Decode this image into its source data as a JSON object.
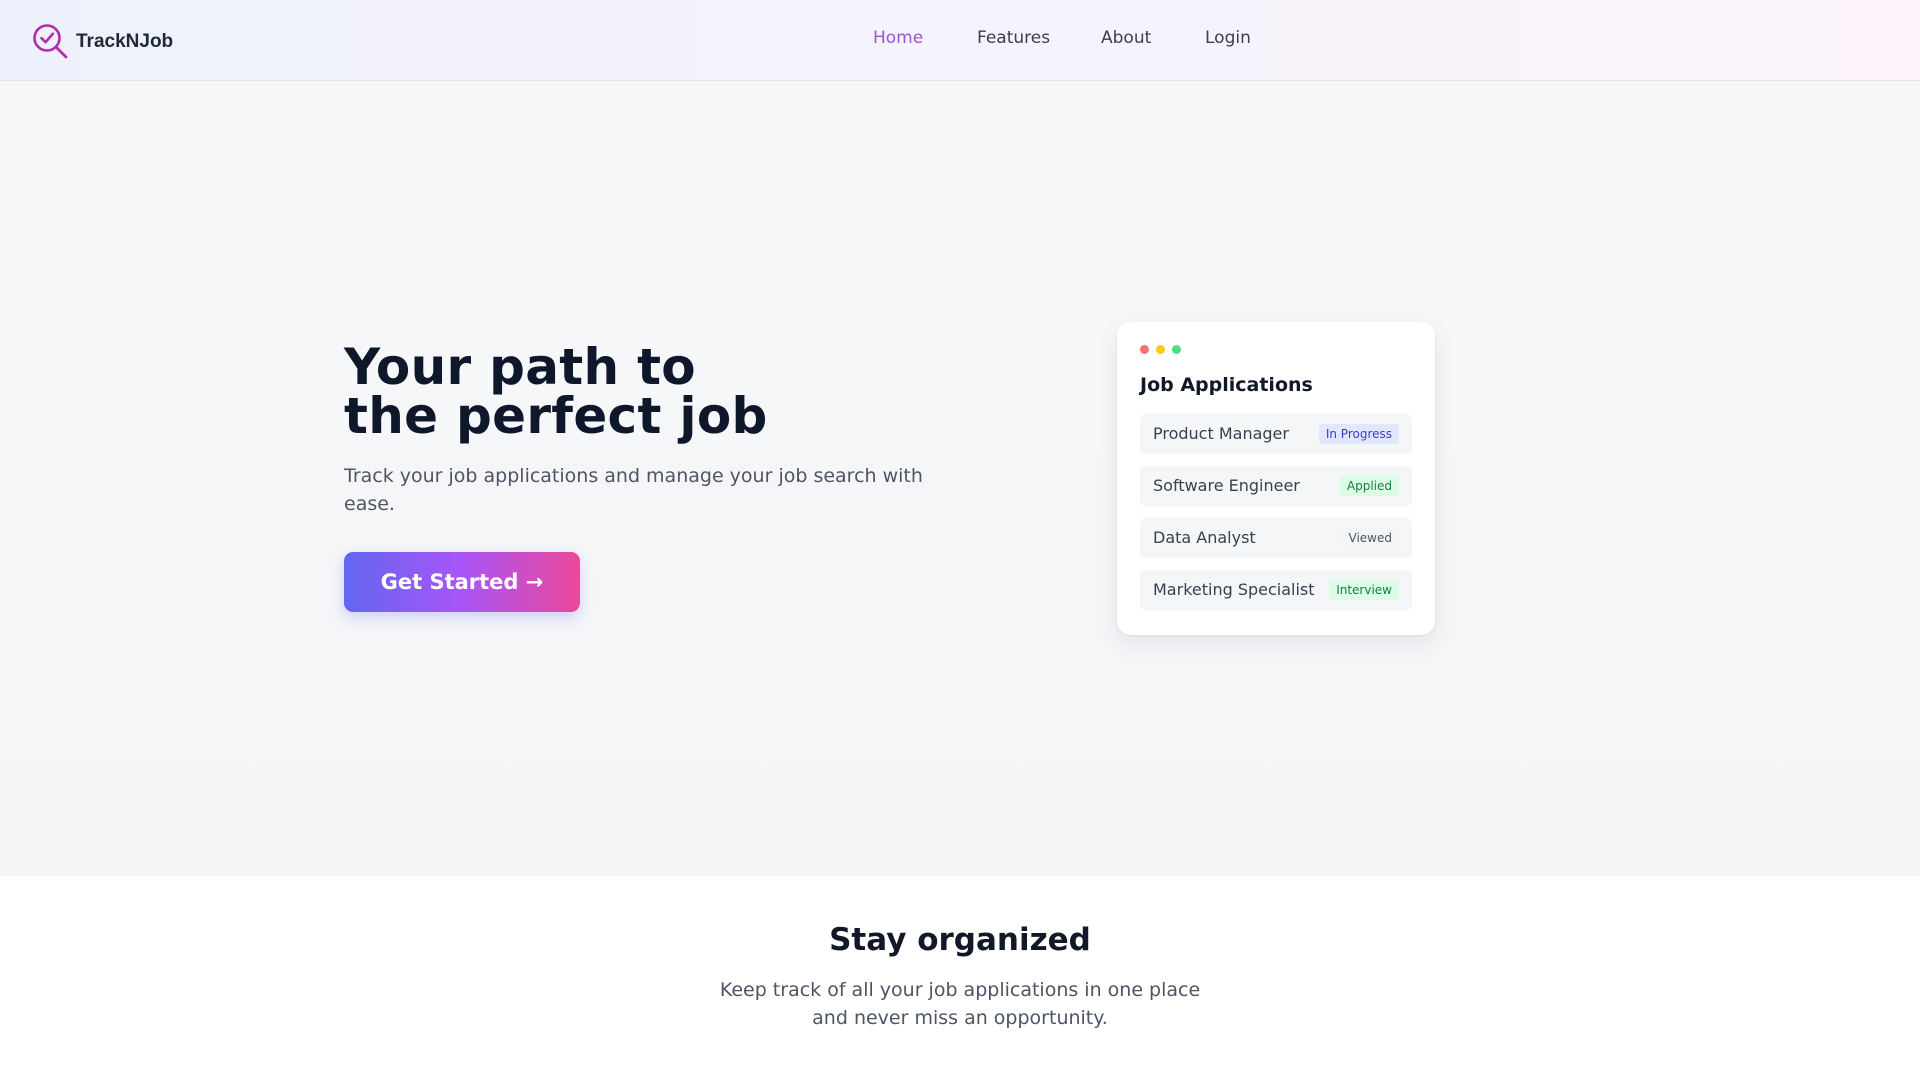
{
  "brand": {
    "name": "TrackNJob",
    "logo_icon": "magnifier-check-icon",
    "accent": "#b02ea8"
  },
  "nav": {
    "items": [
      {
        "label": "Home",
        "active": true
      },
      {
        "label": "Features",
        "active": false
      },
      {
        "label": "About",
        "active": false
      },
      {
        "label": "Login",
        "active": false
      }
    ],
    "active_color": "#9b51d9"
  },
  "hero": {
    "title_line1": "Your path to",
    "title_line2": "the perfect job",
    "subtitle": "Track your job applications and manage your job search with ease.",
    "cta_label": "Get Started →",
    "cta_gradient": [
      "#6366f1",
      "#a855f7",
      "#ec4899"
    ]
  },
  "card": {
    "title": "Job Applications",
    "window_dots": [
      "#f87171",
      "#facc15",
      "#4ade80"
    ],
    "applications": [
      {
        "role": "Product Manager",
        "status": "In Progress",
        "badge_bg": "#e0e7ff",
        "badge_fg": "#4338ca"
      },
      {
        "role": "Software Engineer",
        "status": "Applied",
        "badge_bg": "#dcfce7",
        "badge_fg": "#15803d"
      },
      {
        "role": "Data Analyst",
        "status": "Viewed",
        "badge_bg": "#f3f4f6",
        "badge_fg": "#4b5563"
      },
      {
        "role": "Marketing Specialist",
        "status": "Interview",
        "badge_bg": "#dcfce7",
        "badge_fg": "#15803d"
      }
    ]
  },
  "section": {
    "title": "Stay organized",
    "subtitle_line1": "Keep track of all your job applications in one place",
    "subtitle_line2": "and never miss an opportunity."
  }
}
